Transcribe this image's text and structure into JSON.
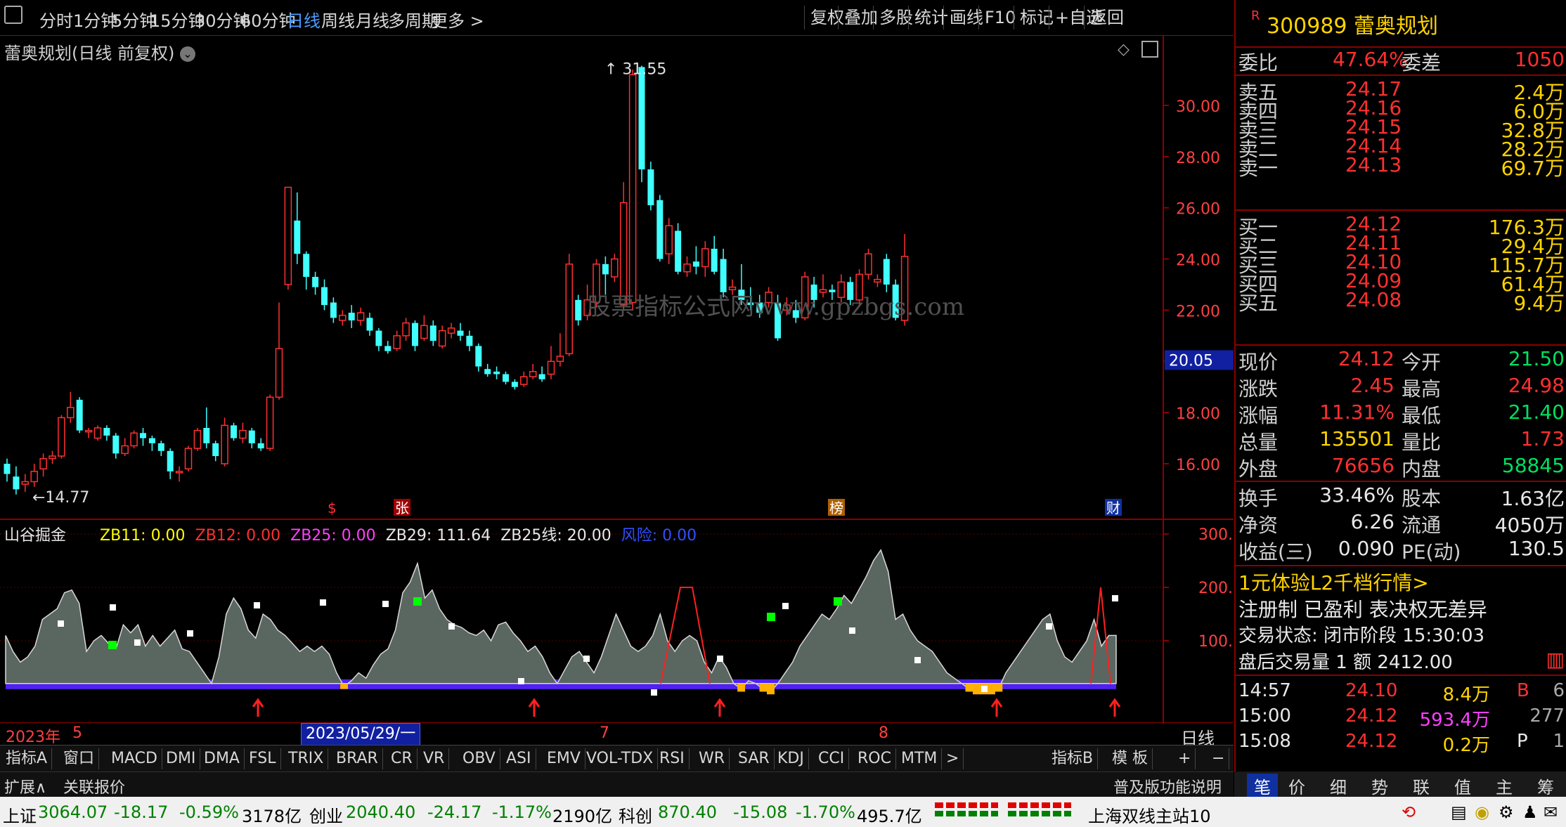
{
  "toolbar": {
    "periods": [
      "分时",
      "1分钟",
      "5分钟",
      "15分钟",
      "30分钟",
      "60分钟",
      "日线",
      "周线",
      "月线",
      "多周期",
      "更多 >"
    ],
    "active_period": "日线",
    "buttons": [
      "复权",
      "叠加",
      "多股",
      "统计",
      "画线",
      "F10",
      "标记",
      "+自选",
      "返回"
    ]
  },
  "chart": {
    "title": "蕾奥规划(日线 前复权)",
    "high_label": "31.55",
    "low_label": "14.77",
    "price_ticks": [
      "30.00",
      "28.00",
      "26.00",
      "24.00",
      "22.00",
      "20.00",
      "18.00",
      "16.00"
    ],
    "price_tag": "20.05",
    "watermark": "股票指标公式网www.gpzbgs.com",
    "markers": [
      "$",
      "张",
      "榜",
      "财"
    ]
  },
  "chart_data": [
    {
      "type": "candlestick",
      "title": "蕾奥规划(日线 前复权)",
      "ylim": [
        14,
        31.9
      ],
      "candles": [
        [
          16.0,
          15.6,
          16.2,
          15.3
        ],
        [
          15.5,
          15.0,
          15.9,
          14.8
        ],
        [
          15.2,
          15.3,
          15.6,
          14.9
        ],
        [
          15.3,
          15.7,
          16.0,
          15.1
        ],
        [
          15.8,
          16.2,
          16.4,
          15.5
        ],
        [
          16.2,
          16.3,
          16.5,
          16.0
        ],
        [
          16.3,
          17.8,
          17.9,
          16.2
        ],
        [
          17.8,
          18.2,
          18.8,
          17.6
        ],
        [
          18.5,
          17.3,
          18.6,
          17.2
        ],
        [
          17.3,
          17.3,
          17.4,
          17.0
        ],
        [
          17.0,
          17.4,
          17.5,
          16.9
        ],
        [
          17.4,
          17.1,
          17.5,
          16.9
        ],
        [
          17.1,
          16.4,
          17.2,
          16.2
        ],
        [
          16.4,
          16.7,
          17.0,
          16.3
        ],
        [
          16.7,
          17.2,
          17.3,
          16.6
        ],
        [
          17.2,
          17.0,
          17.4,
          16.7
        ],
        [
          17.0,
          16.8,
          17.1,
          16.5
        ],
        [
          16.8,
          16.5,
          16.9,
          16.3
        ],
        [
          16.5,
          15.7,
          16.6,
          15.4
        ],
        [
          15.7,
          15.7,
          15.9,
          15.3
        ],
        [
          15.8,
          16.6,
          16.7,
          15.7
        ],
        [
          16.6,
          17.3,
          17.4,
          16.5
        ],
        [
          17.4,
          16.8,
          18.2,
          16.6
        ],
        [
          16.8,
          16.3,
          16.9,
          16.1
        ],
        [
          16.0,
          17.5,
          17.8,
          15.9
        ],
        [
          17.5,
          17.0,
          17.6,
          16.9
        ],
        [
          17.0,
          17.3,
          17.6,
          16.8
        ],
        [
          17.3,
          16.8,
          17.4,
          16.6
        ],
        [
          16.8,
          16.6,
          17.0,
          16.5
        ],
        [
          16.6,
          18.6,
          18.7,
          16.5
        ],
        [
          18.6,
          20.5,
          22.3,
          18.5
        ],
        [
          23.0,
          26.8,
          26.8,
          22.8
        ],
        [
          25.5,
          24.2,
          26.6,
          23.8
        ],
        [
          24.2,
          23.3,
          24.3,
          22.8
        ],
        [
          23.3,
          22.9,
          23.5,
          22.6
        ],
        [
          22.9,
          22.2,
          23.2,
          22.0
        ],
        [
          22.3,
          21.7,
          22.5,
          21.5
        ],
        [
          21.6,
          21.8,
          22.0,
          21.4
        ],
        [
          21.9,
          21.6,
          22.2,
          21.3
        ],
        [
          21.6,
          21.9,
          22.1,
          21.4
        ],
        [
          21.7,
          21.2,
          21.9,
          21.0
        ],
        [
          21.2,
          20.6,
          21.3,
          20.4
        ],
        [
          20.6,
          20.4,
          20.8,
          20.3
        ],
        [
          20.5,
          21.0,
          21.2,
          20.4
        ],
        [
          21.0,
          21.5,
          21.7,
          20.8
        ],
        [
          21.5,
          20.6,
          21.6,
          20.4
        ],
        [
          20.9,
          21.4,
          21.8,
          20.8
        ],
        [
          21.4,
          20.8,
          21.6,
          20.6
        ],
        [
          20.6,
          21.2,
          21.4,
          20.5
        ],
        [
          21.1,
          21.3,
          21.5,
          20.9
        ],
        [
          21.2,
          21.0,
          21.5,
          20.8
        ],
        [
          21.0,
          20.6,
          21.2,
          20.4
        ],
        [
          20.6,
          19.8,
          20.7,
          19.6
        ],
        [
          19.7,
          19.5,
          19.9,
          19.4
        ],
        [
          19.6,
          19.5,
          19.8,
          19.3
        ],
        [
          19.5,
          19.2,
          19.6,
          19.1
        ],
        [
          19.2,
          19.0,
          19.3,
          18.9
        ],
        [
          19.1,
          19.4,
          19.6,
          19.0
        ],
        [
          19.4,
          19.6,
          19.9,
          19.3
        ],
        [
          19.5,
          19.3,
          19.8,
          19.2
        ],
        [
          19.5,
          20.0,
          20.6,
          19.3
        ],
        [
          20.0,
          20.2,
          21.1,
          19.8
        ],
        [
          20.3,
          23.8,
          24.2,
          20.2
        ],
        [
          22.4,
          21.6,
          22.6,
          21.4
        ],
        [
          21.8,
          22.4,
          23.0,
          21.6
        ],
        [
          22.3,
          23.8,
          24.0,
          22.1
        ],
        [
          23.8,
          23.4,
          24.1,
          22.6
        ],
        [
          23.3,
          24.0,
          24.2,
          23.1
        ],
        [
          22.2,
          26.2,
          27.0,
          22.0
        ],
        [
          22.3,
          31.2,
          31.4,
          22.0
        ],
        [
          31.5,
          27.5,
          31.55,
          27.0
        ],
        [
          27.5,
          26.1,
          27.8,
          25.9
        ],
        [
          26.3,
          24.0,
          26.5,
          23.9
        ],
        [
          24.2,
          25.3,
          25.6,
          23.8
        ],
        [
          25.1,
          23.5,
          25.4,
          23.4
        ],
        [
          23.5,
          23.8,
          24.1,
          23.3
        ],
        [
          23.9,
          23.7,
          24.5,
          23.4
        ],
        [
          23.7,
          24.4,
          24.7,
          23.3
        ],
        [
          24.4,
          23.5,
          24.9,
          23.4
        ],
        [
          24.0,
          22.7,
          24.4,
          22.5
        ],
        [
          22.8,
          22.9,
          23.2,
          22.6
        ],
        [
          22.8,
          22.4,
          23.8,
          22.2
        ],
        [
          22.3,
          22.2,
          22.9,
          22.0
        ],
        [
          22.3,
          21.9,
          22.6,
          21.7
        ],
        [
          22.3,
          22.7,
          22.9,
          22.1
        ],
        [
          22.3,
          20.9,
          22.6,
          20.8
        ],
        [
          22.0,
          22.2,
          22.5,
          21.8
        ],
        [
          22.0,
          21.7,
          22.4,
          21.5
        ],
        [
          21.7,
          23.3,
          23.5,
          21.6
        ],
        [
          23.0,
          22.4,
          23.3,
          22.1
        ],
        [
          22.7,
          22.8,
          23.4,
          22.5
        ],
        [
          22.8,
          22.7,
          23.0,
          22.4
        ],
        [
          22.5,
          23.1,
          23.4,
          22.3
        ],
        [
          23.1,
          22.4,
          23.3,
          22.2
        ],
        [
          22.4,
          23.4,
          23.6,
          22.2
        ],
        [
          23.4,
          24.2,
          24.4,
          23.2
        ],
        [
          23.1,
          23.2,
          23.4,
          22.9
        ],
        [
          24.0,
          23.0,
          24.2,
          22.7
        ],
        [
          23.0,
          21.7,
          23.2,
          21.6
        ],
        [
          21.6,
          24.1,
          24.98,
          21.4
        ]
      ]
    },
    {
      "type": "area",
      "title": "山谷掘金",
      "ylim": [
        0,
        330
      ],
      "series": [
        {
          "name": "ZB29",
          "values": [
            110,
            80,
            60,
            70,
            90,
            140,
            150,
            160,
            190,
            195,
            170,
            80,
            100,
            110,
            95,
            85,
            130,
            115,
            130,
            90,
            110,
            90,
            105,
            120,
            85,
            80,
            60,
            40,
            20,
            70,
            150,
            180,
            160,
            120,
            105,
            150,
            140,
            120,
            110,
            95,
            80,
            90,
            80,
            90,
            75,
            40,
            15,
            25,
            40,
            30,
            55,
            75,
            85,
            120,
            190,
            210,
            245,
            180,
            195,
            160,
            140,
            130,
            125,
            115,
            110,
            120,
            100,
            130,
            135,
            115,
            100,
            80,
            90,
            70,
            40,
            20,
            45,
            70,
            80,
            60,
            40,
            70,
            110,
            150,
            120,
            90,
            80,
            90,
            110,
            150,
            100,
            80,
            100,
            110,
            100,
            60,
            40,
            70,
            50,
            20,
            10,
            25,
            20,
            10,
            5,
            20,
            40,
            60,
            90,
            110,
            130,
            150,
            140,
            160,
            185,
            170,
            195,
            220,
            250,
            270,
            230,
            140,
            150,
            120,
            100,
            90,
            80,
            60,
            40,
            30,
            20,
            10,
            5,
            5,
            5,
            10,
            40,
            60,
            80,
            100,
            120,
            140,
            150,
            100,
            70,
            60,
            80,
            100,
            140,
            90,
            110,
            110
          ]
        },
        {
          "name": "ZB25线",
          "values": [
            20
          ]
        }
      ],
      "legend": [
        "ZB11: 0.00",
        "ZB12: 0.00",
        "ZB25: 0.00",
        "ZB29: 111.64",
        "ZB25线: 20.00",
        "风险: 0.00"
      ]
    }
  ],
  "axis": {
    "sub_ticks": [
      "300.0",
      "200.0",
      "100.0"
    ],
    "dates": [
      "2023年",
      "5",
      "2023/05/29/一",
      "7",
      "8"
    ],
    "period_label": "日线"
  },
  "indicator": {
    "name": "山谷掘金",
    "legend": [
      {
        "text": "ZB11: 0.00",
        "color": "#ffff00"
      },
      {
        "text": "ZB12: 0.00",
        "color": "#ff3030"
      },
      {
        "text": "ZB25: 0.00",
        "color": "#ff40ff"
      },
      {
        "text": "ZB29: 111.64",
        "color": "#e8e8e8"
      },
      {
        "text": "ZB25线: 20.00",
        "color": "#e8e8e8"
      },
      {
        "text": "风险: 0.00",
        "color": "#3050ff"
      }
    ]
  },
  "tabs": [
    "指标A",
    "窗口",
    "MACD",
    "DMI",
    "DMA",
    "FSL",
    "TRIX",
    "BRAR",
    "CR",
    "VR",
    "OBV",
    "ASI",
    "EMV",
    "VOL-TDX",
    "RSI",
    "WR",
    "SAR",
    "KDJ",
    "CCI",
    "ROC",
    "MTM",
    ">"
  ],
  "tabs_right": [
    "指标B",
    "模 板",
    "+",
    "−"
  ],
  "ext": {
    "expand": "扩展∧",
    "related": "关联报价",
    "help": "普及版功能说明"
  },
  "quote": {
    "badge": "R",
    "code_name": "300989 蕾奥规划",
    "weibi_label": "委比",
    "weibi": "47.64%",
    "weicha_label": "委差",
    "weicha": "1050",
    "asks": [
      {
        "label": "卖五",
        "price": "24.17",
        "vol": "2.4万"
      },
      {
        "label": "卖四",
        "price": "24.16",
        "vol": "6.0万"
      },
      {
        "label": "卖三",
        "price": "24.15",
        "vol": "32.8万"
      },
      {
        "label": "卖二",
        "price": "24.14",
        "vol": "28.2万"
      },
      {
        "label": "卖一",
        "price": "24.13",
        "vol": "69.7万"
      }
    ],
    "bids": [
      {
        "label": "买一",
        "price": "24.12",
        "vol": "176.3万"
      },
      {
        "label": "买二",
        "price": "24.11",
        "vol": "29.4万"
      },
      {
        "label": "买三",
        "price": "24.10",
        "vol": "115.7万"
      },
      {
        "label": "买四",
        "price": "24.09",
        "vol": "61.4万"
      },
      {
        "label": "买五",
        "price": "24.08",
        "vol": "9.4万"
      }
    ],
    "stats": [
      {
        "l1": "现价",
        "v1": "24.12",
        "l2": "今开",
        "v2": "21.50",
        "c1": "red",
        "c2": "grn"
      },
      {
        "l1": "涨跌",
        "v1": "2.45",
        "l2": "最高",
        "v2": "24.98",
        "c1": "red",
        "c2": "red"
      },
      {
        "l1": "涨幅",
        "v1": "11.31%",
        "l2": "最低",
        "v2": "21.40",
        "c1": "red",
        "c2": "grn"
      },
      {
        "l1": "总量",
        "v1": "135501",
        "l2": "量比",
        "v2": "1.73",
        "c1": "yel",
        "c2": "red"
      },
      {
        "l1": "外盘",
        "v1": "76656",
        "l2": "内盘",
        "v2": "58845",
        "c1": "red",
        "c2": "grn"
      }
    ],
    "fund": [
      {
        "l1": "换手",
        "v1": "33.46%",
        "l2": "股本",
        "v2": "1.63亿"
      },
      {
        "l1": "净资",
        "v1": "6.26",
        "l2": "流通",
        "v2": "4050万"
      },
      {
        "l1": "收益(三)",
        "v1": "0.090",
        "l2": "PE(动)",
        "v2": "130.5"
      }
    ],
    "promo": "1元体验L2千档行情>",
    "info1": "注册制 已盈利 表决权无差异",
    "info2": "交易状态: 闭市阶段 15:30:03",
    "info3": "盘后交易量 1 额 2412.00",
    "ticks": [
      {
        "time": "14:57",
        "price": "24.10",
        "vol": "8.4万",
        "flag": "B",
        "n": "6"
      },
      {
        "time": "15:00",
        "price": "24.12",
        "vol": "593.4万",
        "flag": "",
        "n": "277"
      },
      {
        "time": "15:08",
        "price": "24.12",
        "vol": "0.2万",
        "flag": "P",
        "n": "1"
      }
    ],
    "bottom_tabs": [
      "笔",
      "价",
      "细",
      "势",
      "联",
      "值",
      "主",
      "筹"
    ]
  },
  "status": {
    "sh": "上证",
    "sh_v": "3064.07",
    "sh_c": "-18.17",
    "sh_p": "-0.59%",
    "sh_a": "3178亿",
    "cy": "创业",
    "cy_v": "2040.40",
    "cy_c": "-24.17",
    "cy_p": "-1.17%",
    "cy_a": "2190亿",
    "kc": "科创",
    "kc_v": "870.40",
    "kc_c": "-15.08",
    "kc_p": "-1.70%",
    "kc_a": "495.7亿",
    "server": "上海双线主站10"
  }
}
